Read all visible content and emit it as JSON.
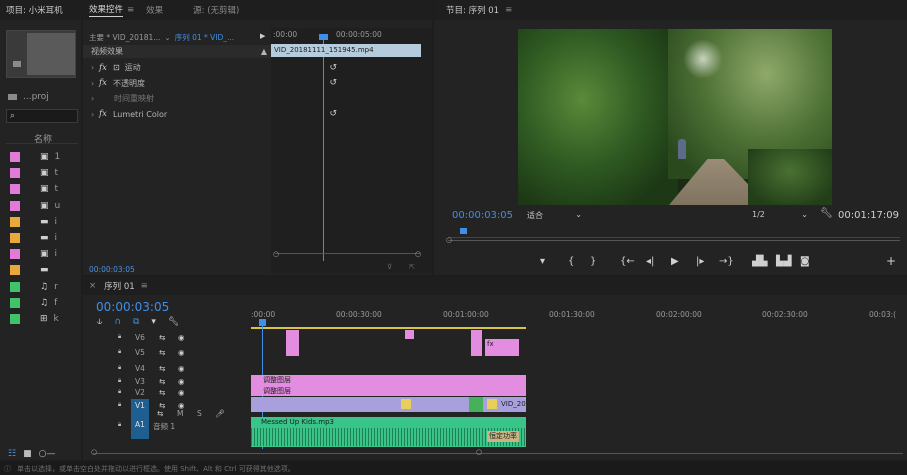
{
  "project_panel": {
    "title": "项目: 小米耳机",
    "file_label": "...proj",
    "column_name": "名称",
    "items": [
      {
        "color": "#e07cd8",
        "icon": "sequence-icon",
        "label": "1"
      },
      {
        "color": "#e07cd8",
        "icon": "sequence-icon",
        "label": "t"
      },
      {
        "color": "#e07cd8",
        "icon": "sequence-icon",
        "label": "t"
      },
      {
        "color": "#e07cd8",
        "icon": "sequence-icon",
        "label": "u"
      },
      {
        "color": "#e8a83a",
        "icon": "folder-icon",
        "label": "i"
      },
      {
        "color": "#e8a83a",
        "icon": "folder-icon",
        "label": "i"
      },
      {
        "color": "#e07cd8",
        "icon": "sequence-icon",
        "label": "i"
      },
      {
        "color": "#e8a83a",
        "icon": "folder-icon",
        "label": ""
      },
      {
        "color": "#3fc46a",
        "icon": "audio-icon",
        "label": "r"
      },
      {
        "color": "#3fc46a",
        "icon": "audio-icon",
        "label": "f"
      },
      {
        "color": "#3fc46a",
        "icon": "video-icon",
        "label": "k"
      }
    ]
  },
  "effect_controls": {
    "tabs": [
      "效果控件",
      "效果",
      "源: (无剪辑)"
    ],
    "menu_icon": "≡",
    "master_label": "主要 * VID_20181...",
    "sequence_label": "序列 01 * VID_...",
    "section_title": "视频效果",
    "effects": [
      {
        "fx": "fx",
        "name": "运动",
        "has_icon": true
      },
      {
        "fx": "fx",
        "name": "不透明度"
      },
      {
        "fx": "",
        "name": "时间重映射"
      },
      {
        "fx": "fx",
        "name": "Lumetri Color"
      }
    ],
    "ruler_start": ":00:00",
    "ruler_mid": "00:00:05:00",
    "clip_name": "VID_20181111_151945.mp4",
    "timecode": "00:00:03:05"
  },
  "program_monitor": {
    "title": "节目: 序列 01",
    "current_time": "00:00:03:05",
    "fit_label": "适合",
    "resolution": "1/2",
    "duration": "00:01:17:09"
  },
  "timeline": {
    "title": "序列 01",
    "timecode": "00:00:03:05",
    "ruler": [
      ":00:00",
      "00:00:30:00",
      "00:01:00:00",
      "00:01:30:00",
      "00:02:00:00",
      "00:02:30:00",
      "00:03:("
    ],
    "tracks": [
      {
        "name": "V6"
      },
      {
        "name": "V5"
      },
      {
        "name": "V4"
      },
      {
        "name": "V3"
      },
      {
        "name": "V2"
      },
      {
        "name": "V1"
      },
      {
        "name": "A1",
        "label": "音频 1"
      }
    ],
    "clip_adjust_1": "调整图层",
    "clip_adjust_2": "调整图层",
    "clip_vid": "VID_20",
    "clip_audio": "Messed Up Kids.mp3",
    "clip_audio_effect": "恒定功率",
    "mute_label": "M",
    "solo_label": "S"
  },
  "status_bar": {
    "text": "单击以选择，或单击空白处并拖动以进行框选。使用 Shift、Alt 和 Ctrl 可获得其他选项。"
  }
}
